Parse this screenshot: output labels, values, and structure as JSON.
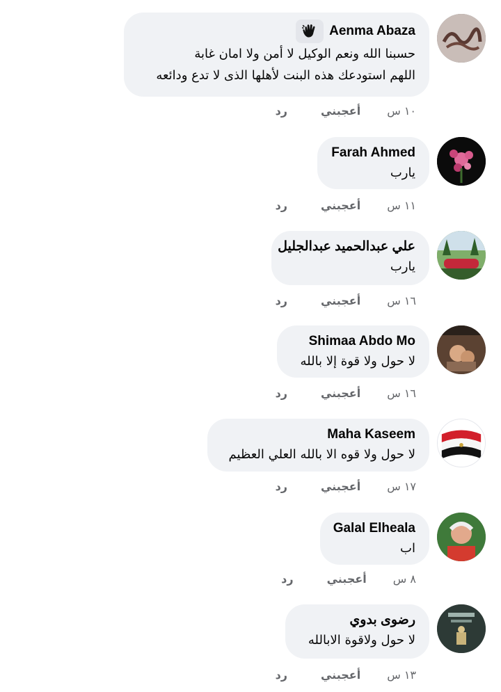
{
  "labels": {
    "like": "أعجبني",
    "reply": "رد"
  },
  "comments": [
    {
      "author": "Aenma Abaza",
      "lines": [
        "حسبنا الله ونعم الوكيل لا أمن ولا امان غابة",
        "اللهم استودعك هذه البنت لأهلها الذى لا تدع ودائعه"
      ],
      "time": "١٠ س",
      "badge": "top-fan-badge"
    },
    {
      "author": "Farah Ahmed",
      "lines": [
        "يارب"
      ],
      "time": "١١ س"
    },
    {
      "author": "علي عبدالحميد عبدالجليل",
      "lines": [
        "يارب"
      ],
      "time": "١٦ س"
    },
    {
      "author": "Shimaa Abdo Mo",
      "lines": [
        "لا حول ولا قوة إلا بالله"
      ],
      "time": "١٦ س"
    },
    {
      "author": "Maha Kaseem",
      "lines": [
        "لا حول ولا قوه الا بالله العلي العظيم"
      ],
      "time": "١٧ س"
    },
    {
      "author": "Galal Elheala",
      "lines": [
        "اب"
      ],
      "time": "٨ س"
    },
    {
      "author": "رضوى بدوي",
      "lines": [
        "لا حول ولاقوة الابالله"
      ],
      "time": "١٣ س"
    }
  ],
  "colors": {
    "bubble": "#f0f2f5",
    "meta": "#65676b",
    "text": "#050505"
  }
}
